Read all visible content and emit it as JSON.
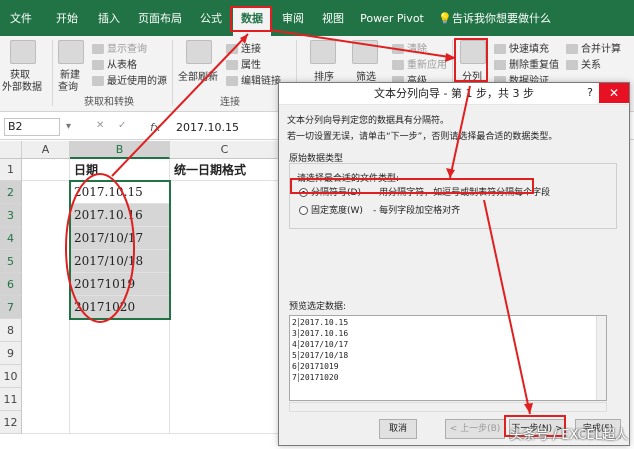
{
  "ribbon_tabs": [
    "文件",
    "开始",
    "插入",
    "页面布局",
    "公式",
    "数据",
    "审阅",
    "视图",
    "Power Pivot"
  ],
  "active_tab": "数据",
  "tell_me": "告诉我你想要做什么",
  "ribbon": {
    "get_external": [
      "获取",
      "外部数据"
    ],
    "new_query": [
      "新建",
      "查询"
    ],
    "show_query": "显示查询",
    "from_table": "从表格",
    "recent_sources": "最近使用的源",
    "group_get_transform": "获取和转换",
    "refresh_all": "全部刷新",
    "connections": "连接",
    "properties": "属性",
    "edit_links": "编辑链接",
    "group_connections": "连接",
    "sort": "排序",
    "filter": "筛选",
    "clear": "清除",
    "reapply": "重新应用",
    "advanced": "高级",
    "text_to_columns": "分列",
    "flash_fill": "快速填充",
    "remove_duplicates": "删除重复值",
    "data_validation": "数据验证",
    "consolidate": "合并计算",
    "relationships": "关系"
  },
  "formula_bar": {
    "name_box": "B2",
    "fx": "fx",
    "value": "2017.10.15"
  },
  "columns": [
    "A",
    "B",
    "C"
  ],
  "rows": [
    "1",
    "2",
    "3",
    "4",
    "5",
    "6",
    "7",
    "8",
    "9",
    "10",
    "11",
    "12"
  ],
  "cells": {
    "B1": "日期",
    "C1": "统一日期格式",
    "B": [
      "2017.10.15",
      "2017.10.16",
      "2017/10/17",
      "2017/10/18",
      "20171019",
      "20171020"
    ]
  },
  "dialog": {
    "title": "文本分列向导 - 第 1 步，共 3 步",
    "help": "?",
    "close": "✕",
    "line1": "文本分列向导判定您的数据具有分隔符。",
    "line2": "若一切设置无误，请单击“下一步”，否则请选择最合适的数据类型。",
    "group_label": "原始数据类型",
    "choose_label": "请选择最合适的文件类型:",
    "radio1_label": "分隔符号(D)",
    "radio1_desc": "- 用分隔字符，如逗号或制表符分隔每个字段",
    "radio2_label": "固定宽度(W)",
    "radio2_desc": "- 每列字段加空格对齐",
    "preview_label": "预览选定数据:",
    "preview_nums": [
      "2",
      "3",
      "4",
      "5",
      "6",
      "7"
    ],
    "preview_lines": [
      "2017.10.15",
      "2017.10.16",
      "2017/10/17",
      "2017/10/18",
      "20171019",
      "20171020"
    ],
    "btn_cancel": "取消",
    "btn_back": "< 上一步(B)",
    "btn_next": "下一步(N) >",
    "btn_finish": "完成(F)"
  },
  "watermark": "头条号 / EXCEL超人",
  "colors": {
    "excel_green": "#217346",
    "annotation_red": "#e02020"
  }
}
